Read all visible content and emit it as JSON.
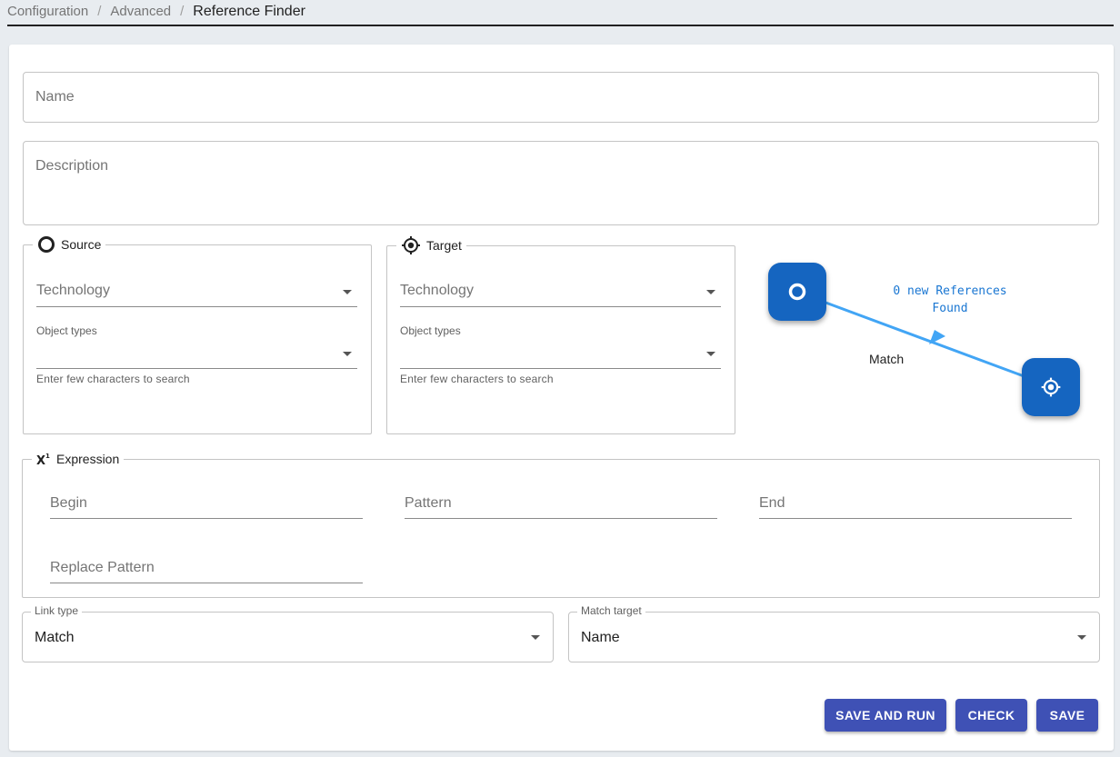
{
  "breadcrumb": {
    "items": [
      "Configuration",
      "Advanced"
    ],
    "separator": "/",
    "current": "Reference Finder"
  },
  "form": {
    "name_placeholder": "Name",
    "description_placeholder": "Description"
  },
  "source": {
    "legend": "Source",
    "technology_placeholder": "Technology",
    "object_types_label": "Object types",
    "helper": "Enter few characters to search"
  },
  "target": {
    "legend": "Target",
    "technology_placeholder": "Technology",
    "object_types_label": "Object types",
    "helper": "Enter few characters to search"
  },
  "diagram": {
    "references_line1": "0 new References",
    "references_line2": "Found",
    "link_label": "Match",
    "colors": {
      "node": "#1565c0",
      "edge": "#42a5f5"
    }
  },
  "expression": {
    "legend": "Expression",
    "begin_placeholder": "Begin",
    "pattern_placeholder": "Pattern",
    "end_placeholder": "End",
    "replace_placeholder": "Replace Pattern"
  },
  "link_type": {
    "label": "Link type",
    "value": "Match"
  },
  "match_target": {
    "label": "Match target",
    "value": "Name"
  },
  "actions": {
    "save_and_run": "SAVE AND RUN",
    "check": "CHECK",
    "save": "SAVE",
    "color": "#3f51b5"
  }
}
